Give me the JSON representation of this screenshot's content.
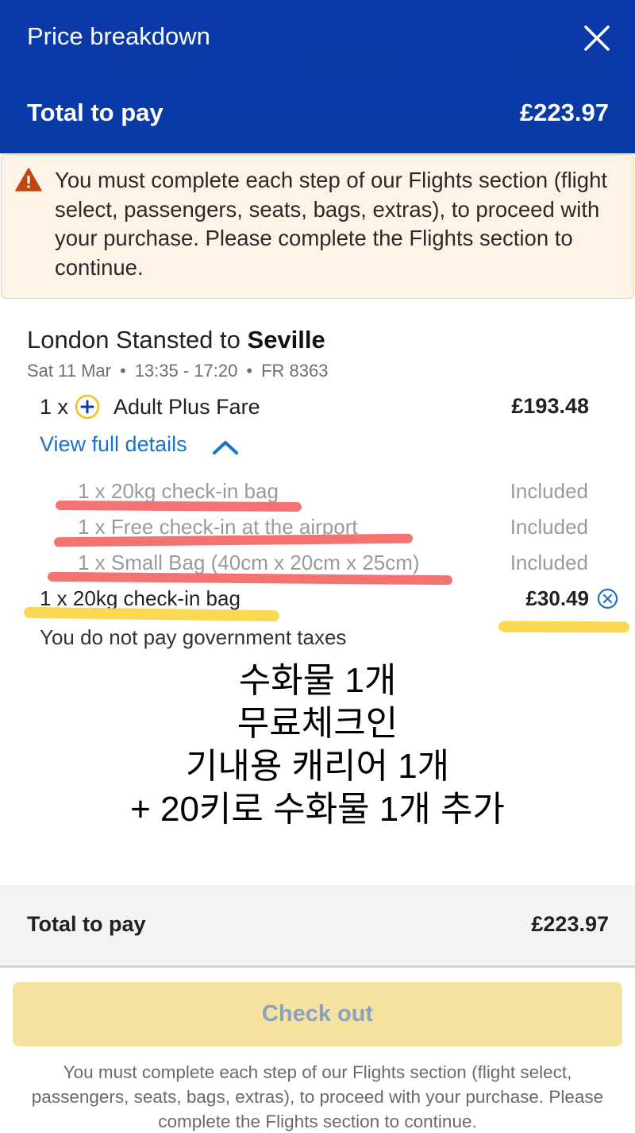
{
  "header": {
    "title": "Price breakdown",
    "total_label": "Total to pay",
    "total_value": "£223.97",
    "close_icon": "close-icon"
  },
  "warning": {
    "icon": "warning-triangle-icon",
    "text": "You must complete each step of our Flights section (flight select, passengers, seats, bags, extras), to proceed with your purchase. Please complete the Flights section to continue."
  },
  "flight": {
    "route_prefix": "London Stansted to ",
    "route_destination": "Seville",
    "date": "Sat 11 Mar",
    "time": "13:35 - 17:20",
    "flight_no": "FR 8363",
    "separator": "•"
  },
  "fare": {
    "qty": "1 x",
    "icon": "plus-fare-icon",
    "name": "Adult Plus Fare",
    "price": "£193.48"
  },
  "details": {
    "link_label": "View full details",
    "included": [
      {
        "item": "1 x 20kg check-in bag",
        "status": "Included"
      },
      {
        "item": "1 x Free check-in at the airport",
        "status": "Included"
      },
      {
        "item": "1 x Small Bag (40cm x 20cm x 25cm)",
        "status": "Included"
      }
    ]
  },
  "extra": {
    "item": "1 x 20kg check-in bag",
    "price": "£30.49",
    "remove_icon": "remove-circle-icon"
  },
  "tax_note": "You do not pay government taxes",
  "annotation": {
    "lines": [
      "수화물 1개",
      "무료체크인",
      "기내용 캐리어 1개",
      "+ 20키로 수화물 1개 추가"
    ]
  },
  "footer": {
    "total_label": "Total to pay",
    "total_value": "£223.97",
    "checkout_label": "Check out",
    "note": "You must complete each step of our Flights section (flight select, passengers, seats, bags, extras), to proceed with your purchase. Please complete the Flights section to continue."
  },
  "colors": {
    "header_bg": "#0b3aa8",
    "link": "#1a73c8",
    "highlight_red": "#f26b6b",
    "highlight_yellow": "#f9d64a",
    "checkout_bg": "#f4e29e"
  }
}
